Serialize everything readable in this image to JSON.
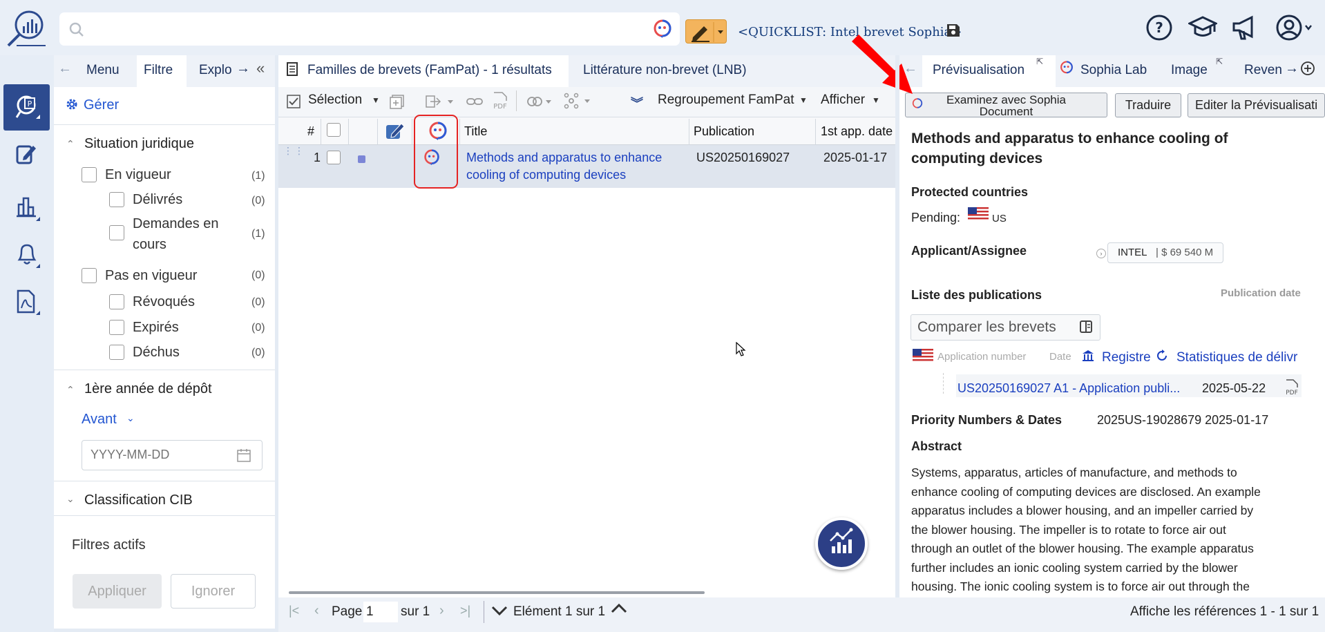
{
  "topbar": {
    "search_placeholder": "",
    "quicklist": "<QUICKLIST: Intel brevet Sophia>"
  },
  "filter": {
    "tabs": [
      "Menu",
      "Filtre",
      "Explo"
    ],
    "manage": "Gérer",
    "legal_status": {
      "title": "Situation juridique",
      "items": [
        {
          "label": "En vigueur",
          "count": "(1)"
        },
        {
          "label": "Délivrés",
          "count": "(0)"
        },
        {
          "label": "Demandes en",
          "label2": "cours",
          "count": "(1)"
        },
        {
          "label": "Pas en vigueur",
          "count": "(0)"
        },
        {
          "label": "Révoqués",
          "count": "(0)"
        },
        {
          "label": "Expirés",
          "count": "(0)"
        },
        {
          "label": "Déchus",
          "count": "(0)"
        }
      ]
    },
    "first_year": {
      "title": "1ère année de dépôt",
      "before": "Avant",
      "date_placeholder": "YYYY-MM-DD"
    },
    "cib": "Classification CIB",
    "active_filters": "Filtres actifs",
    "apply": "Appliquer",
    "ignore": "Ignorer"
  },
  "center": {
    "tabs": [
      "Familles de brevets (FamPat) - 1 résultats",
      "Littérature non-brevet (LNB)"
    ],
    "toolbar": {
      "selection": "Sélection",
      "grouping": "Regroupement FamPat",
      "display": "Afficher"
    },
    "columns": [
      "#",
      "Title",
      "Publication",
      "1st app. date"
    ],
    "rows": [
      {
        "num": "1",
        "title_line1": "Methods and apparatus to enhance",
        "title_line2": "cooling of computing devices",
        "publication": "US20250169027",
        "date": "2025-01-17"
      }
    ],
    "pager": {
      "page_label": "Page",
      "page": "1",
      "of": "sur 1",
      "element": "Elément 1 sur 1"
    },
    "references": "Affiche les références 1 - 1 sur 1"
  },
  "preview": {
    "tabs": [
      "Prévisualisation",
      "Sophia Lab",
      "Image",
      "Reven"
    ],
    "btn_sophia_line1": "Examinez avec Sophia",
    "btn_sophia_line2": "Document",
    "btn_translate": "Traduire",
    "btn_edit": "Editer la Prévisualisati",
    "title_line1": "Methods and apparatus to enhance cooling of",
    "title_line2": "computing devices",
    "protected_countries": "Protected countries",
    "pending": "Pending:",
    "country": "US",
    "applicant_label": "Applicant/Assignee",
    "applicant": "INTEL",
    "applicant_value": "| $ 69 540 M",
    "publications_label": "Liste des publications",
    "publication_date_hdr": "Publication date",
    "compare": "Comparer les brevets",
    "app_number_hdr": "Application number",
    "date_hdr": "Date",
    "registry": "Registre",
    "stats": "Statistiques de délivr",
    "pub_link": "US20250169027 A1 - Application publi...",
    "pub_date": "2025-05-22",
    "priority_label": "Priority Numbers & Dates",
    "priority_value": "2025US-19028679 2025-01-17",
    "abstract_label": "Abstract",
    "abstract_lines": [
      "Systems, apparatus, articles of manufacture, and methods to",
      "enhance cooling of computing devices are disclosed. An example",
      "apparatus includes a blower housing, and an impeller carried by",
      "the blower housing. The impeller is to rotate to force air out",
      "through an outlet of the blower housing. The example apparatus",
      "further includes an ionic cooling system carried by the blower",
      "housing. The ionic cooling system is to force air out through the"
    ]
  },
  "colors": {
    "accent": "#2d4b8f",
    "link": "#1a3fbf",
    "highlight": "#f3b45d",
    "annotation_red": "#e52323"
  }
}
